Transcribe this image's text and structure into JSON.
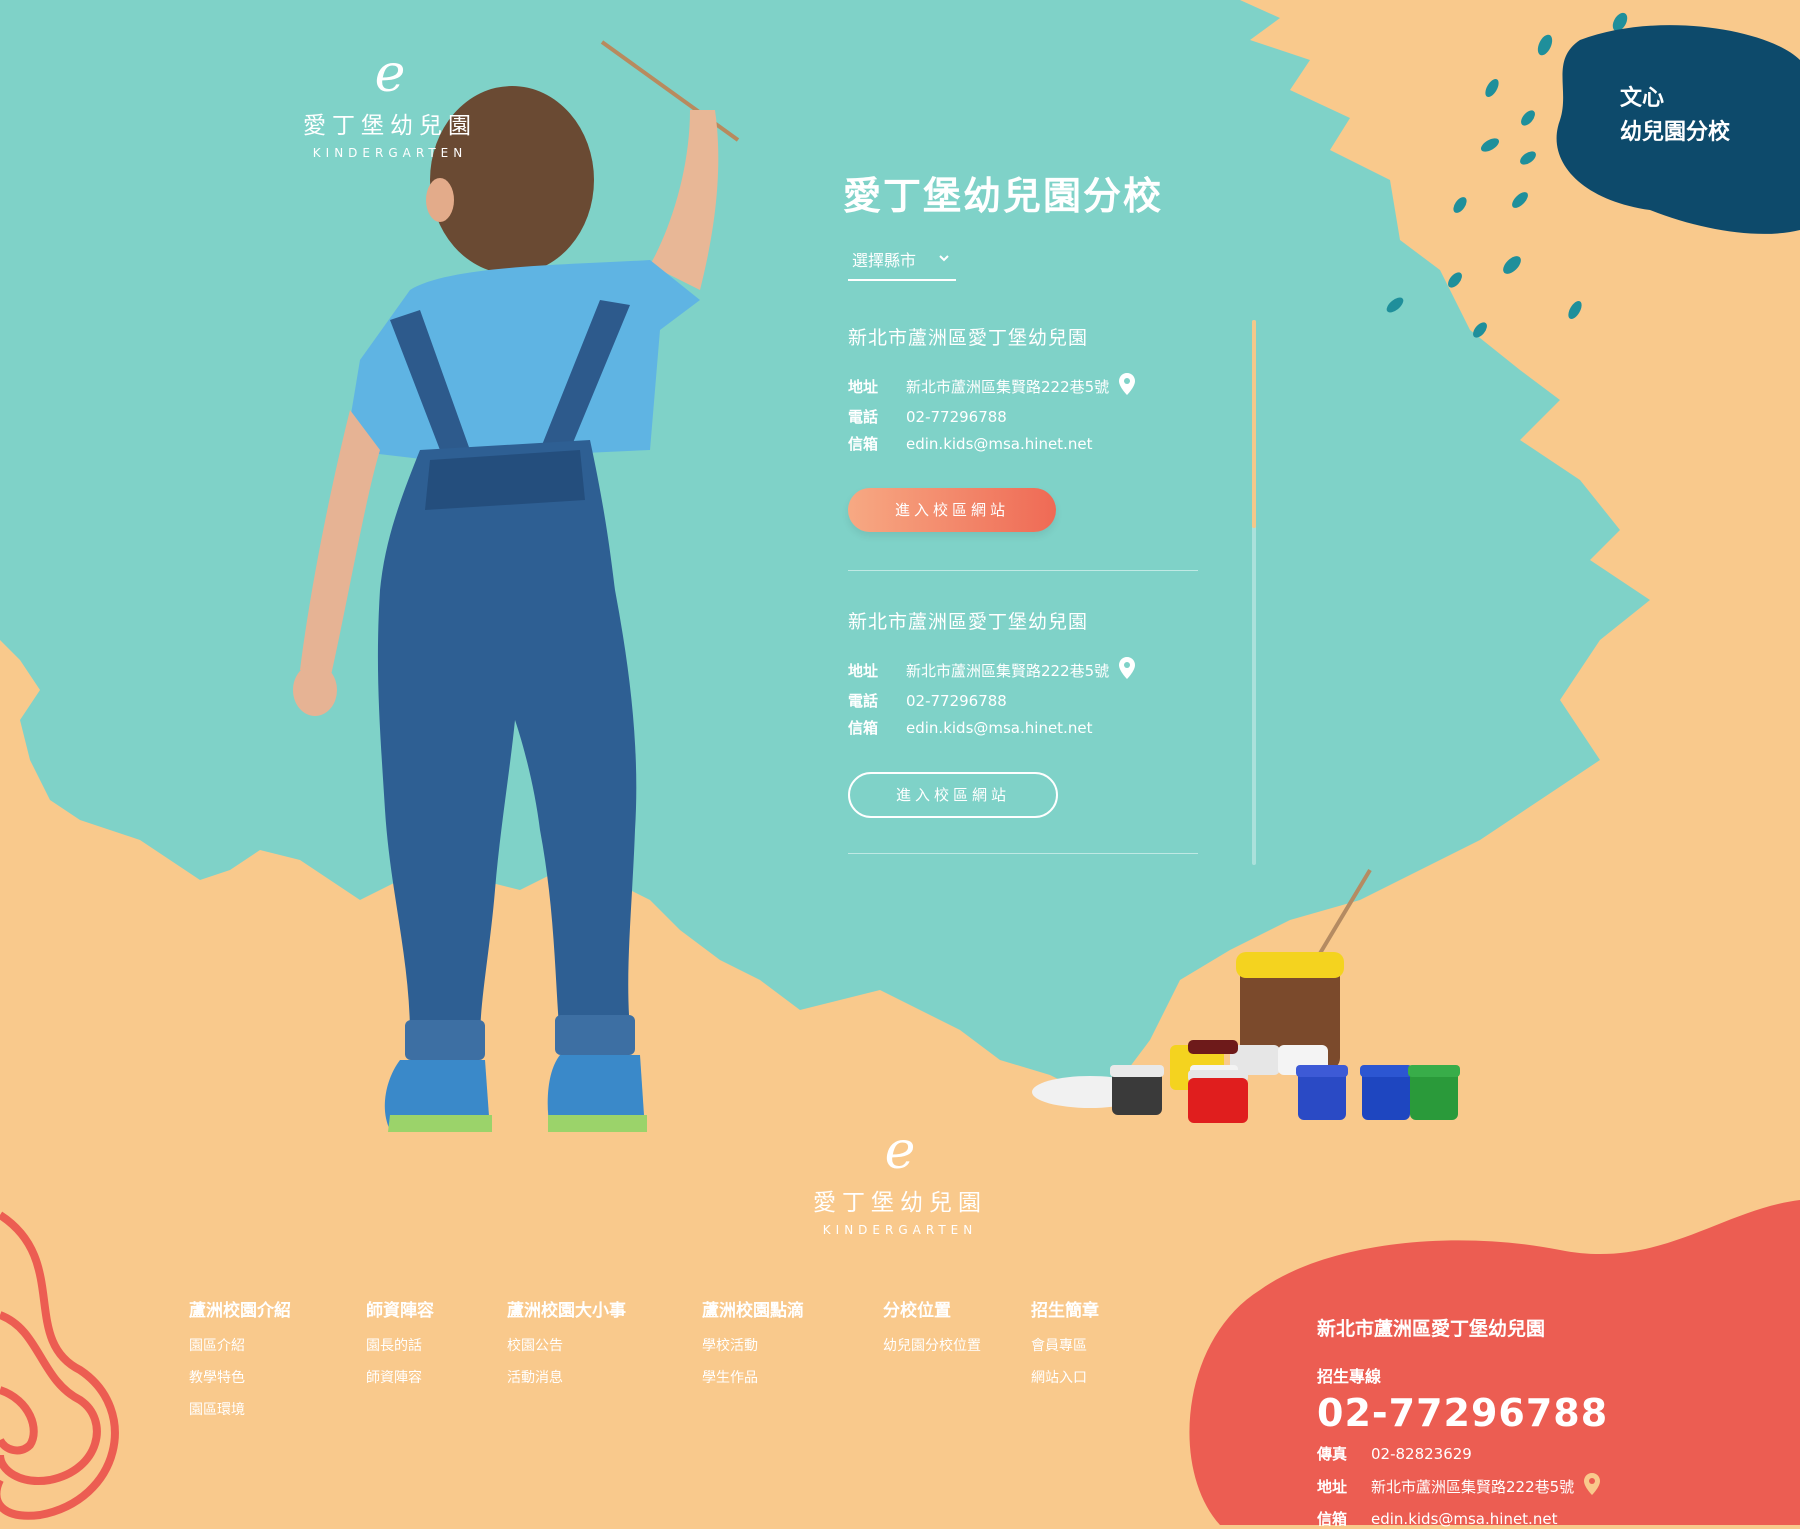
{
  "brand": {
    "logo_mark": "e",
    "name": "愛丁堡幼兒園",
    "subtitle": "KINDERGARTEN"
  },
  "badge": {
    "line1": "文心",
    "line2": "幼兒園分校"
  },
  "panel": {
    "title": "愛丁堡幼兒園分校",
    "select_label": "選擇縣市",
    "branches": [
      {
        "name": "新北市蘆洲區愛丁堡幼兒園",
        "address_label": "地址",
        "address": "新北市蘆洲區集賢路222巷5號",
        "phone_label": "電話",
        "phone": "02-77296788",
        "email_label": "信箱",
        "email": "edin.kids@msa.hinet.net",
        "button": "進入校區網站"
      },
      {
        "name": "新北市蘆洲區愛丁堡幼兒園",
        "address_label": "地址",
        "address": "新北市蘆洲區集賢路222巷5號",
        "phone_label": "電話",
        "phone": "02-77296788",
        "email_label": "信箱",
        "email": "edin.kids@msa.hinet.net",
        "button": "進入校區網站"
      }
    ]
  },
  "footer_nav": [
    {
      "title": "蘆洲校園介紹",
      "items": [
        "園區介紹",
        "教學特色",
        "園區環境"
      ]
    },
    {
      "title": "師資陣容",
      "items": [
        "園長的話",
        "師資陣容"
      ]
    },
    {
      "title": "蘆洲校園大小事",
      "items": [
        "校園公告",
        "活動消息"
      ]
    },
    {
      "title": "蘆洲校園點滴",
      "items": [
        "學校活動",
        "學生作品"
      ]
    },
    {
      "title": "分校位置",
      "items": [
        "幼兒園分校位置"
      ]
    },
    {
      "title": "招生簡章",
      "items": [
        "會員專區",
        "網站入口"
      ]
    }
  ],
  "contact": {
    "name": "新北市蘆洲區愛丁堡幼兒園",
    "hotline_label": "招生專線",
    "hotline": "02-77296788",
    "fax_label": "傳真",
    "fax": "02-82823629",
    "address_label": "地址",
    "address": "新北市蘆洲區集賢路222巷5號",
    "email_label": "信箱",
    "email": "edin.kids@msa.hinet.net"
  },
  "colors": {
    "teal": "#7fd2c8",
    "peach": "#f9c98c",
    "navy": "#0d4a6b",
    "coral": "#ec5d52",
    "button_start": "#f7a983",
    "button_end": "#ef6a55"
  }
}
